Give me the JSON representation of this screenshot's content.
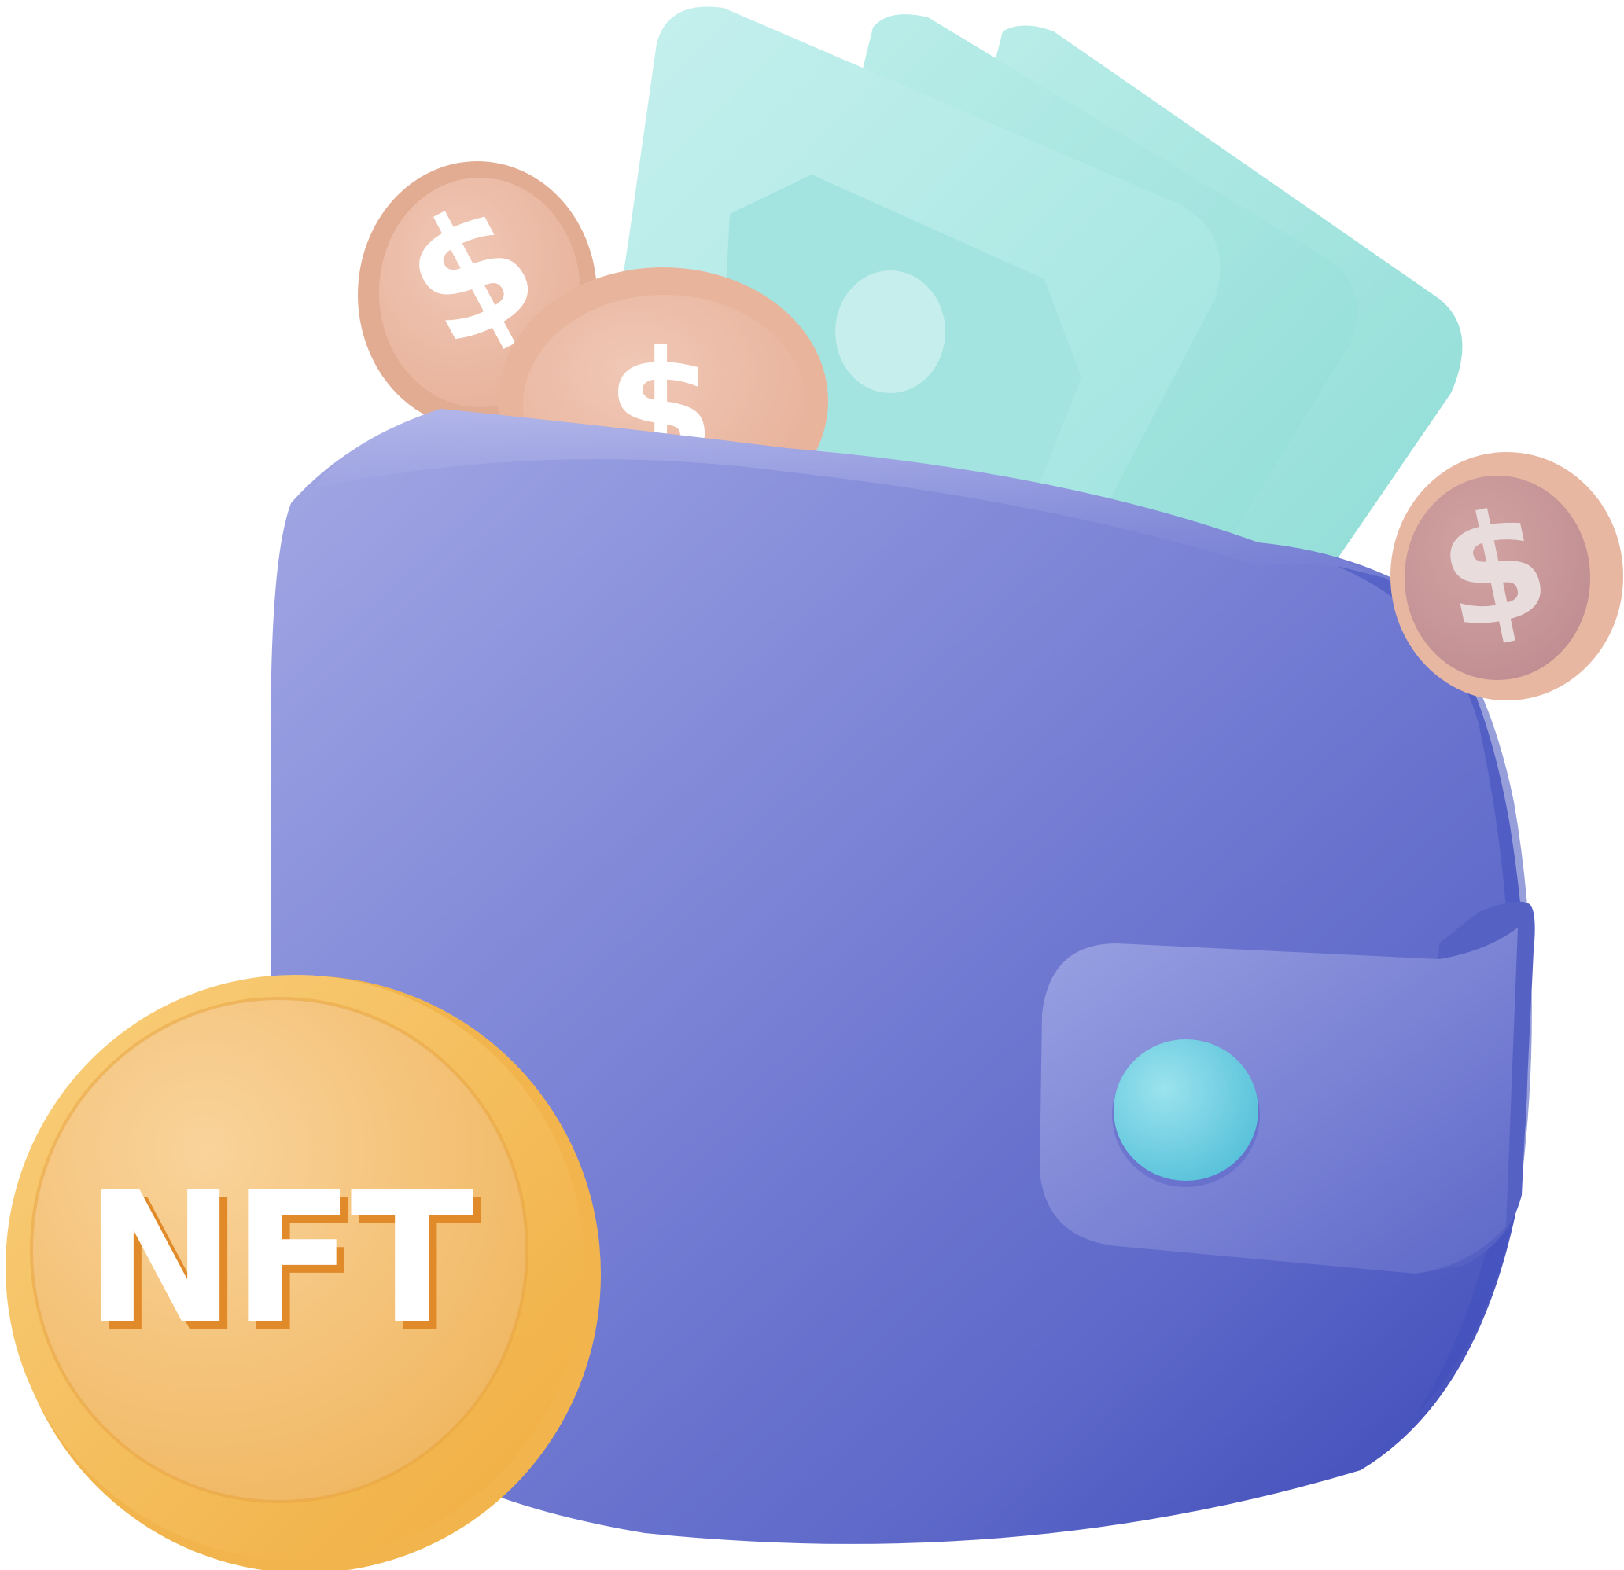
{
  "illustration": {
    "nft_coin": {
      "label": "NFT"
    },
    "dollar_coins": [
      {
        "symbol": "$"
      },
      {
        "symbol": "$"
      },
      {
        "symbol": "$"
      }
    ]
  },
  "colors": {
    "background": "#ffffff",
    "wallet": "#6e78cf",
    "wallet_dark": "#3f4cb8",
    "wallet_light": "#a9aee6",
    "strap": "#7c86d6",
    "button": "#6ec9df",
    "banknote": "#aeeae6",
    "banknote_dark": "#8fdcd8",
    "dollar_coin": "#eebda4",
    "nft_coin": "#f6c36a",
    "nft_coin_rim": "#f2b44a"
  }
}
